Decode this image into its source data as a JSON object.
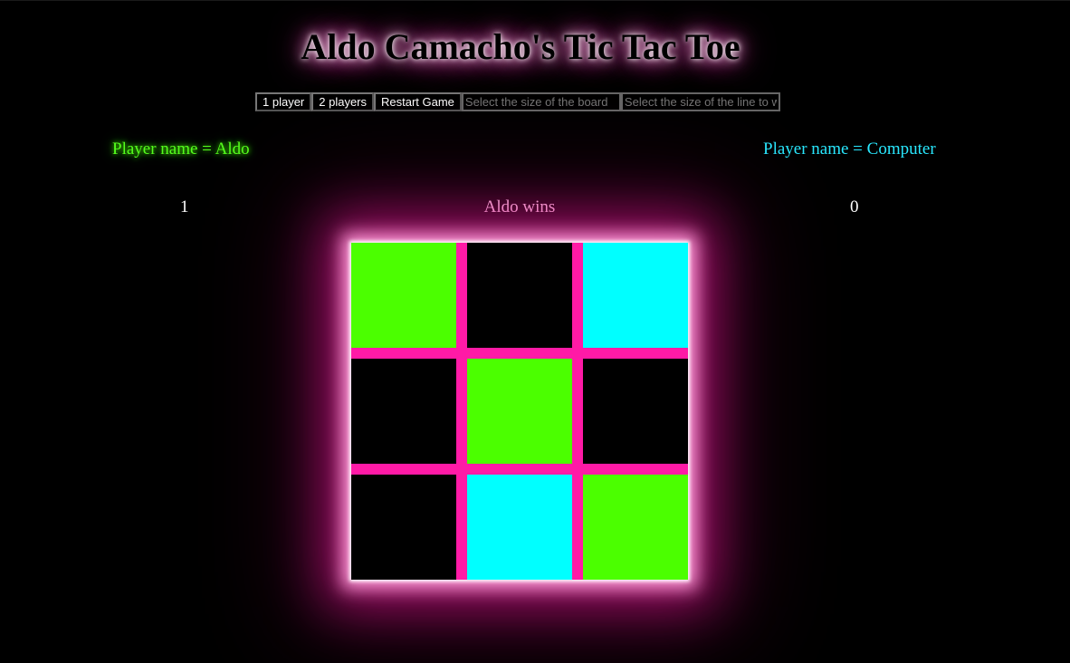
{
  "title": "Aldo Camacho's Tic Tac Toe",
  "controls": {
    "one_player_label": "1 player",
    "two_players_label": "2 players",
    "restart_label": "Restart Game",
    "board_size_placeholder": "Select the size of the board",
    "line_size_placeholder": "Select the size of the line to win"
  },
  "players": {
    "p1": {
      "name_text": "Player name = Aldo",
      "score": "1",
      "color": "#4bff00"
    },
    "p2": {
      "name_text": "Player name = Computer",
      "score": "0",
      "color": "#00ffff"
    }
  },
  "status": "Aldo wins",
  "board": {
    "size": 3,
    "cells": [
      [
        "p1",
        "",
        "p2"
      ],
      [
        "",
        "p1",
        ""
      ],
      [
        "",
        "p2",
        "p1"
      ]
    ],
    "line_color": "#ff1aa6"
  }
}
